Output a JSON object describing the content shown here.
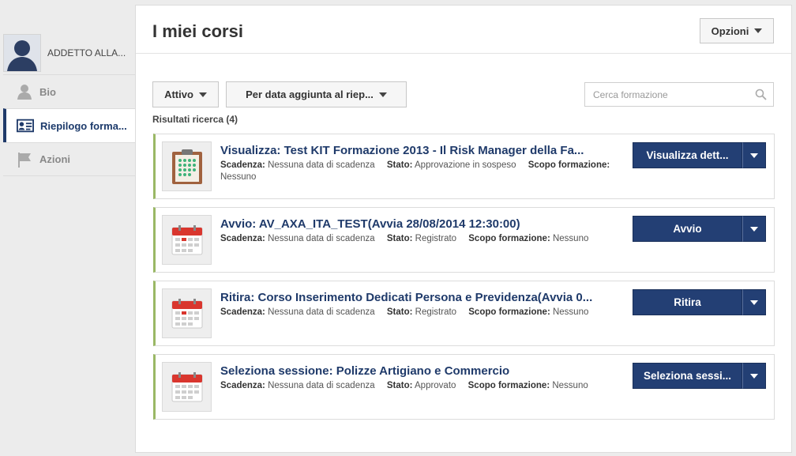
{
  "sidebar": {
    "profile_name": "ADDETTO ALLA...",
    "items": [
      {
        "label": "Bio",
        "icon": "person-icon"
      },
      {
        "label": "Riepilogo forma...",
        "icon": "transcript-icon"
      },
      {
        "label": "Azioni",
        "icon": "flag-icon"
      }
    ]
  },
  "header": {
    "title": "I miei corsi",
    "options_label": "Opzioni"
  },
  "filters": {
    "status": "Attivo",
    "sort": "Per data aggiunta al riep...",
    "search_placeholder": "Cerca formazione"
  },
  "results": {
    "label": "Risultati ricerca (4)"
  },
  "labels": {
    "due": "Scadenza:",
    "status": "Stato:",
    "scope": "Scopo formazione:"
  },
  "courses": [
    {
      "title": "Visualizza: Test KIT Formazione 2013 - Il Risk Manager della Fa...",
      "due": "Nessuna data di scadenza",
      "status": "Approvazione in sospeso",
      "scope": "Nessuno",
      "action": "Visualizza dett...",
      "icon": "checklist-icon"
    },
    {
      "title": "Avvio: AV_AXA_ITA_TEST(Avvia 28/08/2014 12:30:00)",
      "due": "Nessuna data di scadenza",
      "status": "Registrato",
      "scope": "Nessuno",
      "action": "Avvio",
      "icon": "calendar-icon"
    },
    {
      "title": "Ritira: Corso Inserimento Dedicati Persona e Previdenza(Avvia 0...",
      "due": "Nessuna data di scadenza",
      "status": "Registrato",
      "scope": "Nessuno",
      "action": "Ritira",
      "icon": "calendar-icon"
    },
    {
      "title": "Seleziona sessione: Polizze Artigiano e Commercio",
      "due": "Nessuna data di scadenza",
      "status": "Approvato",
      "scope": "Nessuno",
      "action": "Seleziona sessi...",
      "icon": "calendar-icon"
    }
  ],
  "colors": {
    "accent": "#233f74",
    "course_border": "#9ab865"
  }
}
